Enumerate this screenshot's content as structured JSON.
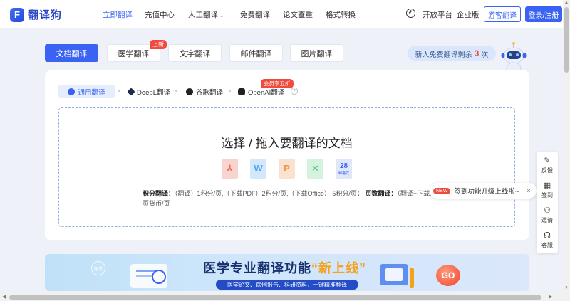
{
  "logo": {
    "mark": "F",
    "text": "翻译狗"
  },
  "nav": {
    "items": [
      {
        "label": "立即翻译",
        "active": true
      },
      {
        "label": "充值中心"
      },
      {
        "label": "人工翻译",
        "dropdown": true
      },
      {
        "label": "免费翻译"
      },
      {
        "label": "论文查重"
      },
      {
        "label": "格式转换"
      }
    ],
    "open_platform": "开放平台",
    "enterprise": "企业版",
    "guest_btn": "游客翻译",
    "login_btn": "登录/注册",
    "language_icon": "language-icon"
  },
  "doc_tabs": [
    {
      "label": "文档翻译",
      "active": true
    },
    {
      "label": "医学翻译",
      "badge": "上新"
    },
    {
      "label": "文字翻译"
    },
    {
      "label": "邮件翻译"
    },
    {
      "label": "图片翻译"
    }
  ],
  "free_notice": {
    "prefix": "新人免费翻译剩余",
    "count": "3",
    "suffix": "次"
  },
  "engines": [
    {
      "label": "通用翻译",
      "active": true
    },
    {
      "label": "DeepL翻译"
    },
    {
      "label": "谷歌翻译"
    },
    {
      "label": "OpenAI翻译",
      "badge": "会员享五折"
    }
  ],
  "upload": {
    "title": "选择 / 拖入要翻译的文档",
    "file_icons": [
      "pdf-icon",
      "word-icon",
      "ppt-icon",
      "excel-icon",
      "formats-icon"
    ],
    "formats_count": "28",
    "formats_label": "种格式"
  },
  "pricing": {
    "points_label": "积分翻译：",
    "points_text": "（翻译）1积分/页,（下载PDF）2积分/页,（下载Office） 5积分/页；",
    "pages_label": "页数翻译：",
    "pages_text": "（翻译+下载）1页货币/页"
  },
  "tooltip": {
    "badge": "NEW",
    "text": "签到功能升级上线啦~",
    "close": "×"
  },
  "sidebar": [
    {
      "label": "反馈",
      "icon": "feedback-icon",
      "glyph": "✎"
    },
    {
      "label": "签到",
      "icon": "calendar-icon",
      "glyph": "▦"
    },
    {
      "label": "邀请",
      "icon": "invite-icon",
      "glyph": "⚇"
    },
    {
      "label": "客服",
      "icon": "headset-icon",
      "glyph": "☊"
    }
  ],
  "banner": {
    "title_main": "医学专业翻译功能",
    "title_highlight": "“新上线”",
    "subtitle": "医学论文、病例报告、科研资料，一键精准翻译",
    "go": "GO",
    "logo_text": "医学"
  },
  "colors": {
    "accent": "#3b63f3",
    "badge_red": "#f04b3e",
    "banner_title": "#17306e"
  }
}
